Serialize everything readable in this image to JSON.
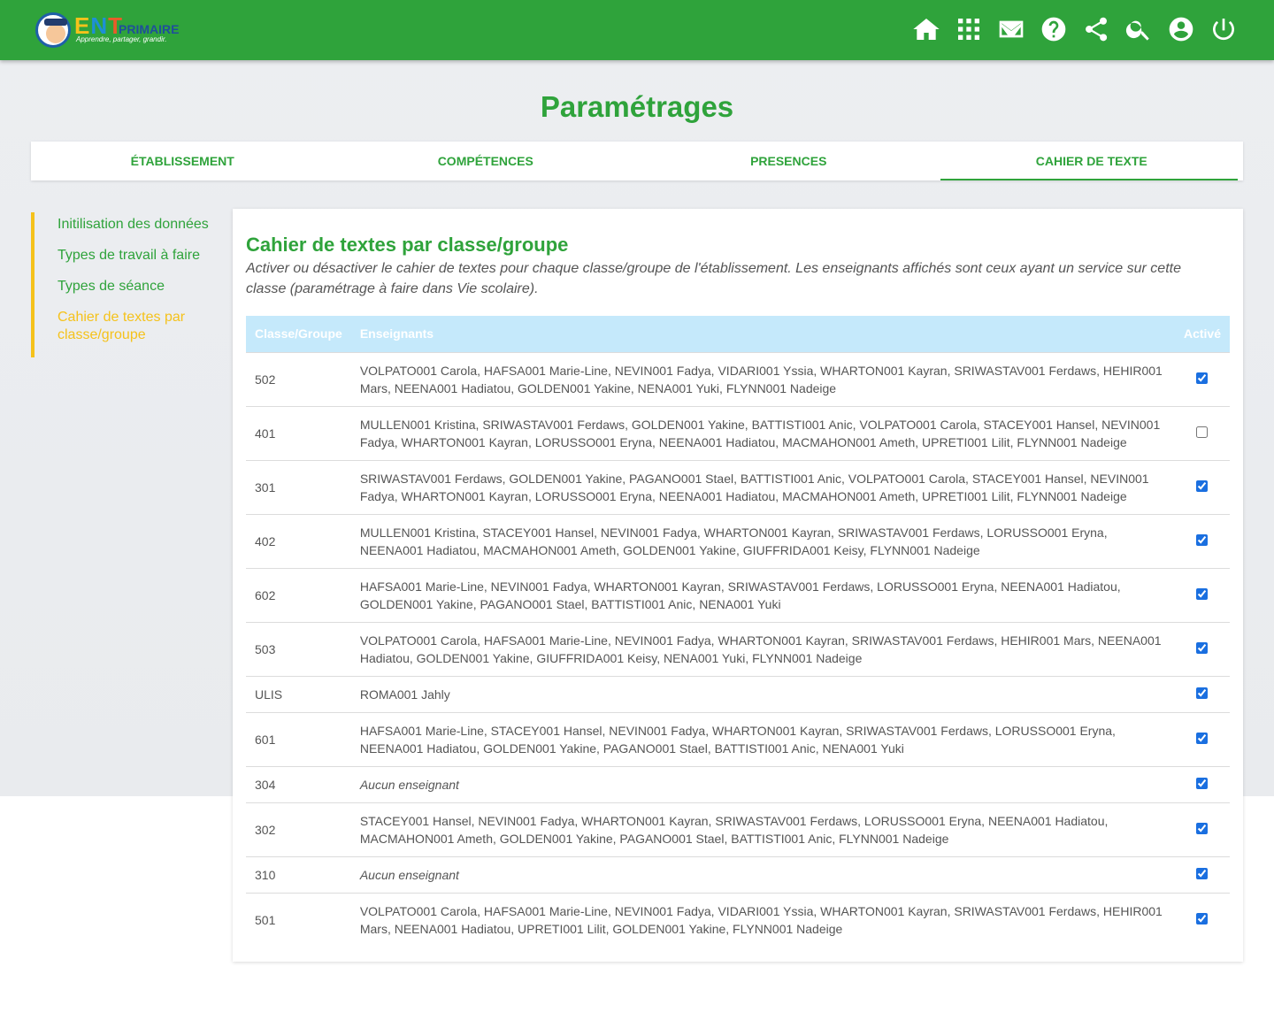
{
  "header": {
    "logo": {
      "ent": "ENT",
      "primaire": "PRIMAIRE",
      "tagline": "Apprendre, partager, grandir."
    },
    "icons": [
      "home-icon",
      "apps-grid-icon",
      "mail-icon",
      "help-icon",
      "share-icon",
      "search-icon",
      "account-icon",
      "power-icon"
    ]
  },
  "page": {
    "title": "Paramétrages"
  },
  "tabs": [
    {
      "label": "ÉTABLISSEMENT"
    },
    {
      "label": "COMPÉTENCES"
    },
    {
      "label": "PRESENCES"
    },
    {
      "label": "CAHIER DE TEXTE",
      "active": true
    }
  ],
  "sidebar": {
    "items": [
      {
        "label": "Initilisation des données"
      },
      {
        "label": "Types de travail à faire"
      },
      {
        "label": "Types de séance"
      },
      {
        "label": "Cahier de textes par classe/groupe",
        "active": true
      }
    ]
  },
  "card": {
    "title": "Cahier de textes par classe/groupe",
    "description": "Activer ou désactiver le cahier de textes pour chaque classe/groupe de l'établissement. Les enseignants affichés sont ceux ayant un service sur cette classe (paramétrage à faire dans Vie scolaire)."
  },
  "table": {
    "headers": {
      "classe": "Classe/Groupe",
      "enseignants": "Enseignants",
      "active": "Activé"
    },
    "rows": [
      {
        "classe": "502",
        "enseignants": "VOLPATO001 Carola, HAFSA001 Marie-Line, NEVIN001 Fadya, VIDARI001 Yssia, WHARTON001 Kayran, SRIWASTAV001 Ferdaws, HEHIR001 Mars, NEENA001 Hadiatou, GOLDEN001 Yakine, NENA001 Yuki, FLYNN001 Nadeige",
        "active": true
      },
      {
        "classe": "401",
        "enseignants": "MULLEN001 Kristina, SRIWASTAV001 Ferdaws, GOLDEN001 Yakine, BATTISTI001 Anic, VOLPATO001 Carola, STACEY001 Hansel, NEVIN001 Fadya, WHARTON001 Kayran, LORUSSO001 Eryna, NEENA001 Hadiatou, MACMAHON001 Ameth, UPRETI001 Lilit, FLYNN001 Nadeige",
        "active": false
      },
      {
        "classe": "301",
        "enseignants": "SRIWASTAV001 Ferdaws, GOLDEN001 Yakine, PAGANO001 Stael, BATTISTI001 Anic, VOLPATO001 Carola, STACEY001 Hansel, NEVIN001 Fadya, WHARTON001 Kayran, LORUSSO001 Eryna, NEENA001 Hadiatou, MACMAHON001 Ameth, UPRETI001 Lilit, FLYNN001 Nadeige",
        "active": true
      },
      {
        "classe": "402",
        "enseignants": "MULLEN001 Kristina, STACEY001 Hansel, NEVIN001 Fadya, WHARTON001 Kayran, SRIWASTAV001 Ferdaws, LORUSSO001 Eryna, NEENA001 Hadiatou, MACMAHON001 Ameth, GOLDEN001 Yakine, GIUFFRIDA001 Keisy, FLYNN001 Nadeige",
        "active": true
      },
      {
        "classe": "602",
        "enseignants": "HAFSA001 Marie-Line, NEVIN001 Fadya, WHARTON001 Kayran, SRIWASTAV001 Ferdaws, LORUSSO001 Eryna, NEENA001 Hadiatou, GOLDEN001 Yakine, PAGANO001 Stael, BATTISTI001 Anic, NENA001 Yuki",
        "active": true
      },
      {
        "classe": "503",
        "enseignants": "VOLPATO001 Carola, HAFSA001 Marie-Line, NEVIN001 Fadya, WHARTON001 Kayran, SRIWASTAV001 Ferdaws, HEHIR001 Mars, NEENA001 Hadiatou, GOLDEN001 Yakine, GIUFFRIDA001 Keisy, NENA001 Yuki, FLYNN001 Nadeige",
        "active": true
      },
      {
        "classe": "ULIS",
        "enseignants": "ROMA001 Jahly",
        "active": true
      },
      {
        "classe": "601",
        "enseignants": "HAFSA001 Marie-Line, STACEY001 Hansel, NEVIN001 Fadya, WHARTON001 Kayran, SRIWASTAV001 Ferdaws, LORUSSO001 Eryna, NEENA001 Hadiatou, GOLDEN001 Yakine, PAGANO001 Stael, BATTISTI001 Anic, NENA001 Yuki",
        "active": true
      },
      {
        "classe": "304",
        "enseignants": "Aucun enseignant",
        "none": true,
        "active": true
      },
      {
        "classe": "302",
        "enseignants": "STACEY001 Hansel, NEVIN001 Fadya, WHARTON001 Kayran, SRIWASTAV001 Ferdaws, LORUSSO001 Eryna, NEENA001 Hadiatou, MACMAHON001 Ameth, GOLDEN001 Yakine, PAGANO001 Stael, BATTISTI001 Anic, FLYNN001 Nadeige",
        "active": true
      },
      {
        "classe": "310",
        "enseignants": "Aucun enseignant",
        "none": true,
        "active": true
      },
      {
        "classe": "501",
        "enseignants": "VOLPATO001 Carola, HAFSA001 Marie-Line, NEVIN001 Fadya, VIDARI001 Yssia, WHARTON001 Kayran, SRIWASTAV001 Ferdaws, HEHIR001 Mars, NEENA001 Hadiatou, UPRETI001 Lilit, GOLDEN001 Yakine, FLYNN001 Nadeige",
        "active": true
      }
    ]
  },
  "colors": {
    "brand_green": "#2fa33b",
    "accent_yellow": "#f5c21b",
    "table_header": "#c5e9fb"
  }
}
